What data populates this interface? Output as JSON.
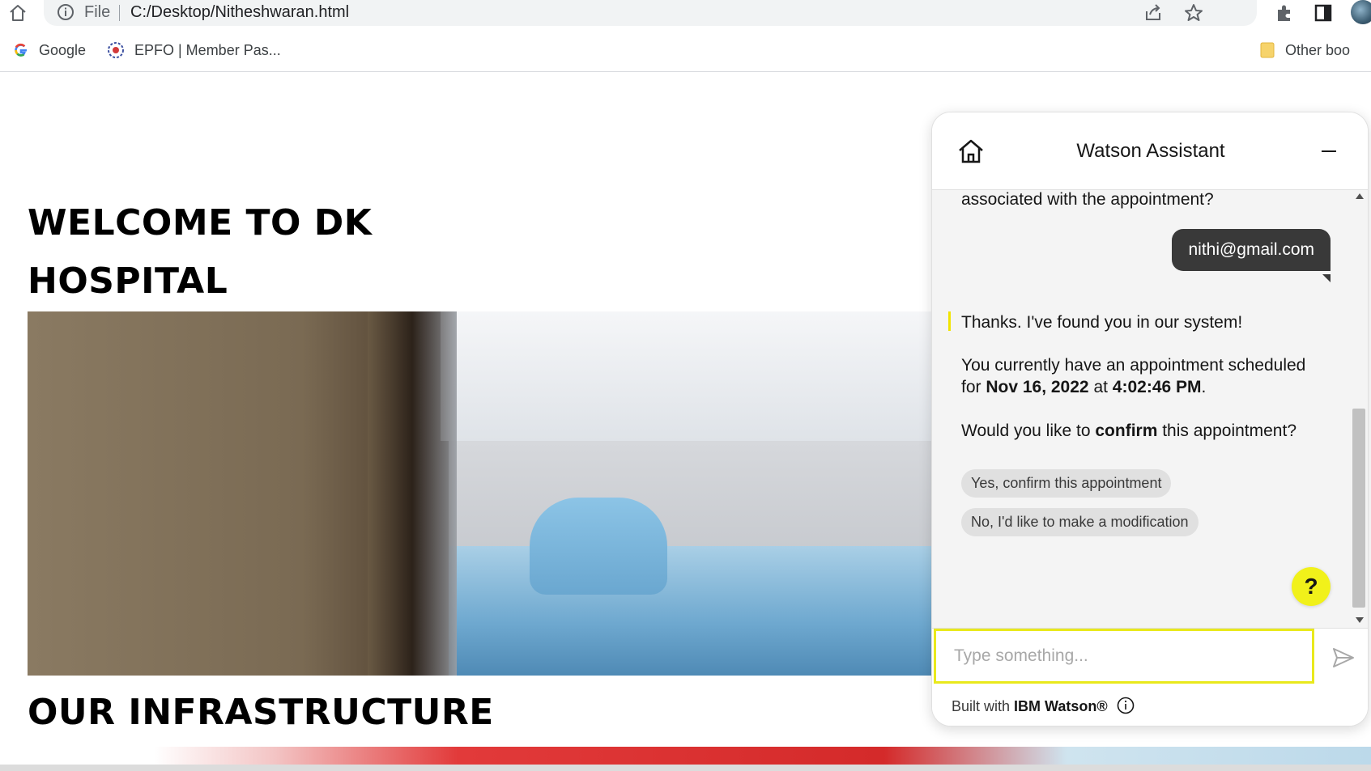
{
  "browser": {
    "scheme_label": "File",
    "url": "C:/Desktop/Nitheshwaran.html",
    "bookmarks": [
      {
        "label": "Google",
        "icon": "google-icon"
      },
      {
        "label": "EPFO | Member Pas...",
        "icon": "epfo-icon"
      }
    ],
    "other_bookmarks": "Other boo"
  },
  "page": {
    "headline_line1": "WELCOME TO DK",
    "headline_line2": "HOSPITAL",
    "section_title": "OUR INFRASTRUCTURE"
  },
  "watson": {
    "title": "Watson Assistant",
    "messages": {
      "previous_tail": "associated with the appointment?",
      "user_email": "nithi@gmail.com",
      "bot_found": "Thanks. I've found you in our system!",
      "bot_schedule_prefix": "You currently have an appointment scheduled for ",
      "bot_schedule_date": "Nov 16, 2022",
      "bot_schedule_mid": " at ",
      "bot_schedule_time": "4:02:46 PM",
      "bot_schedule_suffix": ".",
      "bot_confirm_prefix": "Would you like to ",
      "bot_confirm_bold": "confirm",
      "bot_confirm_suffix": " this appointment?"
    },
    "options": [
      "Yes, confirm this appointment",
      "No, I'd like to make a modification"
    ],
    "help_label": "?",
    "input_placeholder": "Type something...",
    "footer_prefix": "Built with ",
    "footer_brand": "IBM Watson®",
    "accent_color": "#f1f11a",
    "user_bubble_color": "#393939"
  }
}
